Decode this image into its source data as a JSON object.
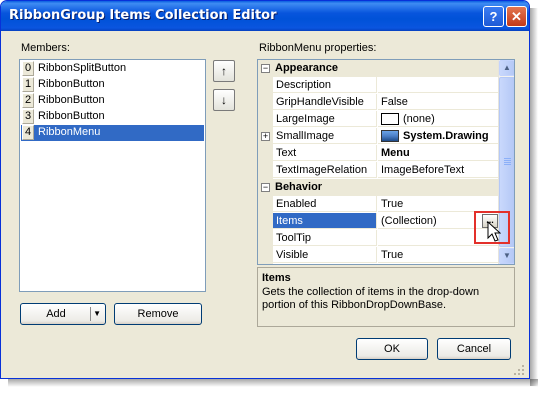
{
  "window": {
    "title": "RibbonGroup Items Collection Editor",
    "help_glyph": "?",
    "close_glyph": "✕"
  },
  "members": {
    "label": "Members:",
    "items": [
      {
        "index": "0",
        "name": "RibbonSplitButton"
      },
      {
        "index": "1",
        "name": "RibbonButton"
      },
      {
        "index": "2",
        "name": "RibbonButton"
      },
      {
        "index": "3",
        "name": "RibbonButton"
      },
      {
        "index": "4",
        "name": "RibbonMenu"
      }
    ],
    "selected_index": 4,
    "move_up_glyph": "↑",
    "move_down_glyph": "↓",
    "add_label": "Add",
    "remove_label": "Remove"
  },
  "properties": {
    "label": "RibbonMenu properties:",
    "categories": [
      {
        "name": "Appearance",
        "rows": [
          {
            "name": "Description",
            "value": ""
          },
          {
            "name": "GripHandleVisible",
            "value": "False"
          },
          {
            "name": "LargeImage",
            "value": "(none)"
          },
          {
            "name": "SmallImage",
            "value": "System.Drawing"
          },
          {
            "name": "Text",
            "value": "Menu"
          },
          {
            "name": "TextImageRelation",
            "value": "ImageBeforeText"
          }
        ]
      },
      {
        "name": "Behavior",
        "rows": [
          {
            "name": "Enabled",
            "value": "True"
          },
          {
            "name": "Items",
            "value": "(Collection)"
          },
          {
            "name": "ToolTip",
            "value": ""
          },
          {
            "name": "Visible",
            "value": "True"
          }
        ]
      }
    ],
    "selected_property": "Items",
    "ellipsis_glyph": "..."
  },
  "description": {
    "title": "Items",
    "text": "Gets the collection of items in the drop-down portion of this RibbonDropDownBase."
  },
  "footer": {
    "ok_label": "OK",
    "cancel_label": "Cancel"
  },
  "colors": {
    "selection": "#316ac5",
    "highlight_box": "#e3302a",
    "titlebar": "#0052d8"
  }
}
